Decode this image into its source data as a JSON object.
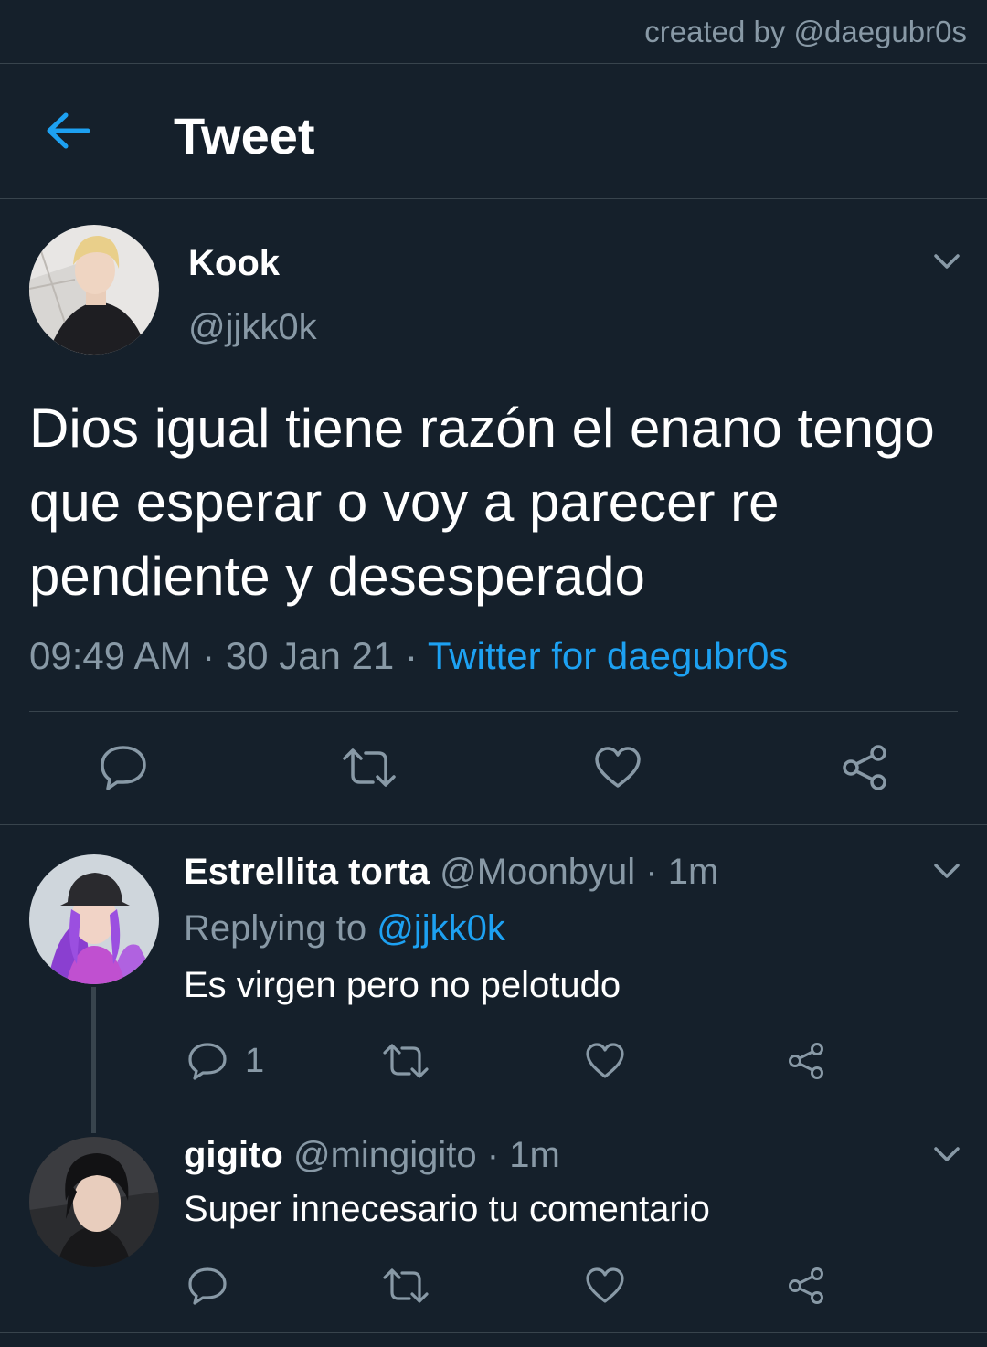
{
  "watermark": "created by @daegubr0s",
  "header": {
    "title": "Tweet",
    "back_icon": "arrow-left-icon"
  },
  "tweet": {
    "author_name": "Kook",
    "author_handle": "@jjkk0k",
    "text": "Dios igual tiene razón el enano tengo que esperar o voy a parecer re pendiente y desesperado",
    "time": "09:49 AM",
    "date": "30 Jan 21",
    "source": "Twitter for daegubr0s"
  },
  "replies": [
    {
      "name": "Estrellita torta",
      "handle": "@Moonbyul",
      "age": "1m",
      "replying_prefix": "Replying to",
      "replying_to": "@jjkk0k",
      "text": "Es virgen pero no pelotudo",
      "reply_count": "1"
    },
    {
      "name": "gigito",
      "handle": "@mingigito",
      "age": "1m",
      "text": "Super innecesario tu comentario"
    }
  ],
  "colors": {
    "background": "#15202b",
    "divider": "#38444d",
    "secondary_text": "#8899a6",
    "accent": "#1da1f2"
  }
}
